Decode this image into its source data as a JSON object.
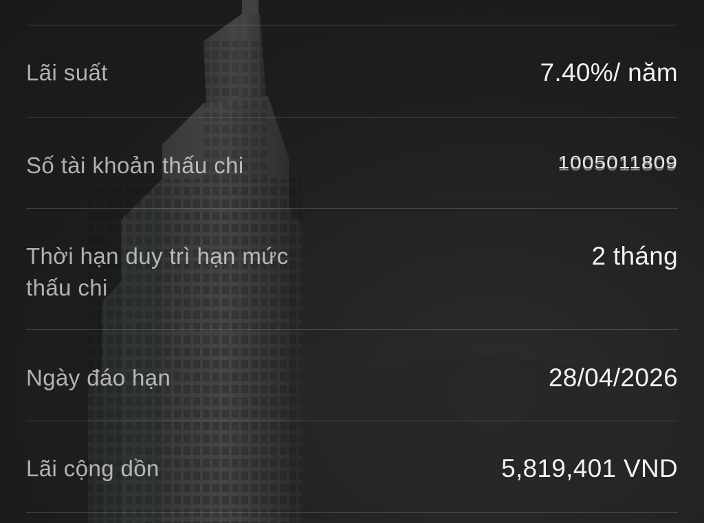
{
  "details": {
    "rows": [
      {
        "label": "Lãi suất",
        "value": "7.40%/ năm"
      },
      {
        "label": "Số tài khoản thấu chi",
        "value": "1005011809"
      },
      {
        "label": "Thời hạn duy trì hạn mức thấu chi",
        "value": "2 tháng"
      },
      {
        "label": "Ngày đáo hạn",
        "value": "28/04/2026"
      },
      {
        "label": "Lãi cộng dồn",
        "value": "5,819,401 VND"
      }
    ]
  },
  "theme": {
    "background": "#1d1f20",
    "label_color": "#b8b8b8",
    "value_color": "#f2f2f2",
    "divider_color": "#3a3c3d"
  }
}
